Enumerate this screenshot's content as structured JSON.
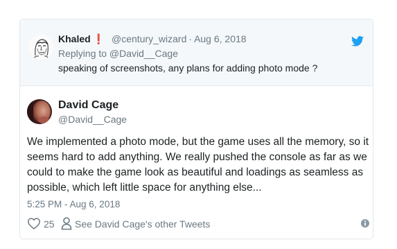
{
  "parent_tweet": {
    "name": "Khaled",
    "exclamation": "❗",
    "handle": "@century_wizard",
    "separator": "·",
    "date": "Aug 6, 2018",
    "replying_to": "Replying to @David__Cage",
    "text": "speaking of screenshots, any plans for adding photo mode ?"
  },
  "main_tweet": {
    "name": "David Cage",
    "handle": "@David__Cage",
    "text": "We implemented a photo mode, but the game uses all the memory, so it seems hard to add anything. We really pushed the console as far as we could to make the game look as beautiful and loadings as seamless as possible, which left little space for anything else...",
    "timestamp": "5:25 PM - Aug 6, 2018"
  },
  "actions": {
    "like_count": "25",
    "see_other_label": "See David Cage's other Tweets"
  },
  "icons": {
    "bird": "twitter-bird-icon",
    "heart": "heart-icon",
    "person": "person-icon",
    "info": "info-icon"
  },
  "colors": {
    "twitter_blue": "#1da1f2",
    "text": "#1c2022",
    "muted": "#697882",
    "border": "#e1e8ed",
    "parent_bg": "#f5f8fa",
    "exclamation": "#e0245e"
  }
}
